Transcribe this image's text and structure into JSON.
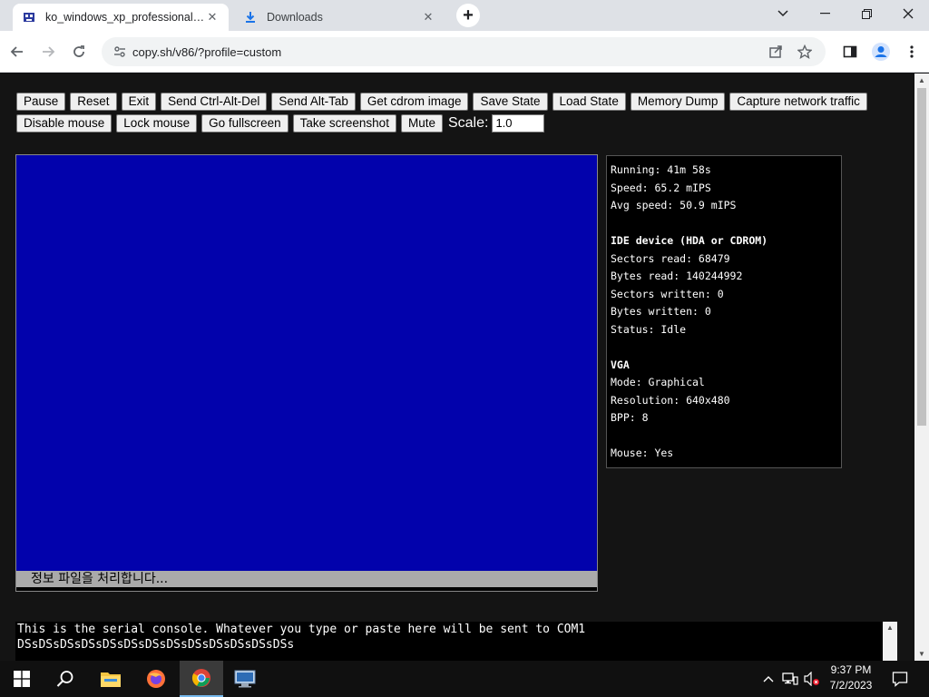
{
  "browser": {
    "tabs": [
      {
        "title": "ko_windows_xp_professional_k...",
        "active": true
      },
      {
        "title": "Downloads",
        "active": false
      }
    ],
    "url": "copy.sh/v86/?profile=custom"
  },
  "controls": {
    "row1": [
      "Pause",
      "Reset",
      "Exit",
      "Send Ctrl-Alt-Del",
      "Send Alt-Tab",
      "Get cdrom image",
      "Save State",
      "Load State",
      "Memory Dump",
      "Capture network traffic"
    ],
    "row2": [
      "Disable mouse",
      "Lock mouse",
      "Go fullscreen",
      "Take screenshot",
      "Mute"
    ],
    "scale_label": "Scale:",
    "scale_value": "1.0"
  },
  "vm": {
    "screen_color": "#0202ac",
    "status_text": "정보 파일을 처리합니다..."
  },
  "info": {
    "running": "Running: 41m 58s",
    "speed": "Speed: 65.2 mIPS",
    "avg_speed": "Avg speed: 50.9 mIPS",
    "ide_header": "IDE device (HDA or CDROM)",
    "sectors_read": "Sectors read: 68479",
    "bytes_read": "Bytes read: 140244992",
    "sectors_written": "Sectors written: 0",
    "bytes_written": "Bytes written: 0",
    "status": "Status: Idle",
    "vga_header": "VGA",
    "mode": "Mode: Graphical",
    "resolution": "Resolution: 640x480",
    "bpp": "BPP: 8",
    "mouse": "Mouse: Yes"
  },
  "serial": {
    "line1": "This is the serial console. Whatever you type or paste here will be sent to COM1",
    "line2": "DSsDSsDSsDSsDSsDSsDSsDSsDSsDSsDSsDSsDSs"
  },
  "taskbar": {
    "time": "9:37 PM",
    "date": "7/2/2023"
  }
}
